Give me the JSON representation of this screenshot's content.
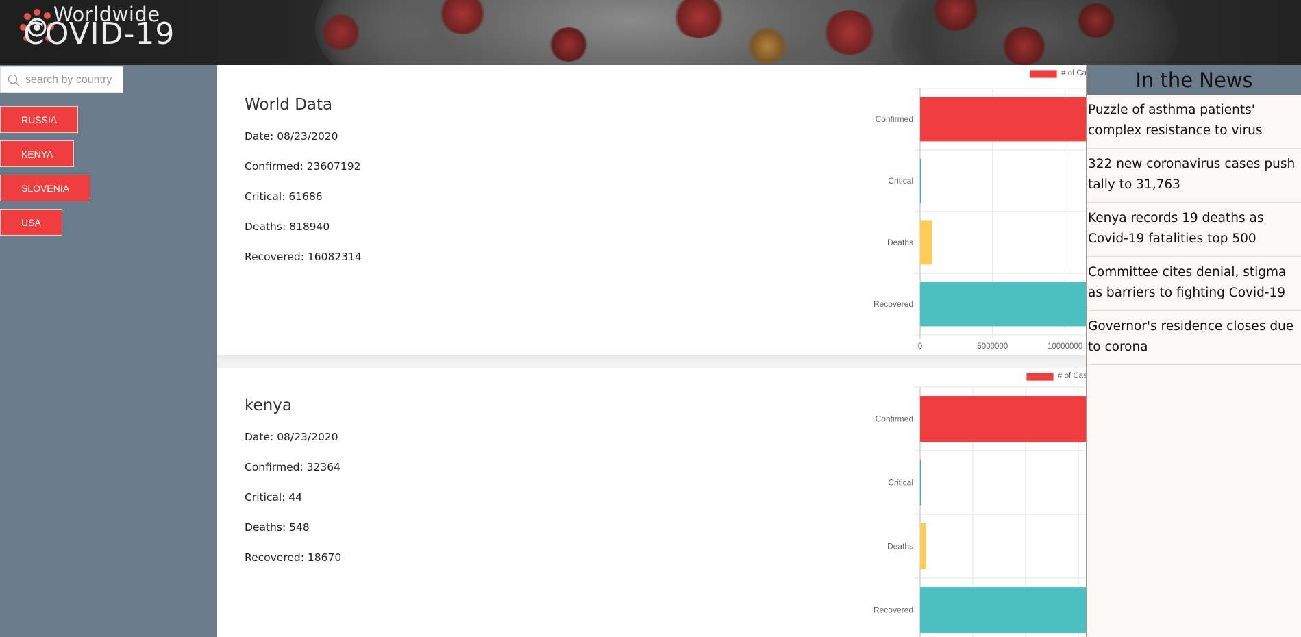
{
  "header": {
    "logo_line1": "Worldwide",
    "logo_line2": "COVID-19"
  },
  "search": {
    "placeholder": "search by country"
  },
  "sidebar": {
    "countries": [
      "RUSSIA",
      "KENYA",
      "SLOVENIA",
      "USA"
    ]
  },
  "world": {
    "title": "World Data",
    "date": "Date: 08/23/2020",
    "confirmed": "Confirmed: 23607192",
    "critical": "Critical: 61686",
    "deaths": "Deaths: 818940",
    "recovered": "Recovered: 16082314"
  },
  "country": {
    "title": "kenya",
    "date": "Date: 08/23/2020",
    "confirmed": "Confirmed: 32364",
    "critical": "Critical: 44",
    "deaths": "Deaths: 548",
    "recovered": "Recovered: 18670"
  },
  "news": {
    "title": "In the News",
    "items": [
      "Puzzle of asthma patients' complex resistance to virus",
      "322 new coronavirus cases push tally to 31,763",
      "Kenya records 19 deaths as Covid-19 fatalities top 500",
      "Committee cites denial, stigma as barriers to fighting Covid-19",
      "Governor's residence closes due to corona"
    ]
  },
  "colors": {
    "confirmed": "#f03e3e",
    "critical": "#36a2eb",
    "deaths": "#ffcd56",
    "recovered": "#4bc0c0",
    "button": "#f03e3e"
  },
  "chart_data": [
    {
      "type": "bar",
      "orientation": "horizontal",
      "legend": "# of Cases Worldwide",
      "categories": [
        "Confirmed",
        "Critical",
        "Deaths",
        "Recovered"
      ],
      "values": [
        23607192,
        61686,
        818940,
        16082314
      ],
      "xlim": [
        0,
        25000000
      ],
      "xticks": [
        "0",
        "5000000",
        "10000000",
        "15000000",
        "20000000",
        "25000000"
      ],
      "grid": true,
      "legend_position": "top"
    },
    {
      "type": "bar",
      "orientation": "horizontal",
      "legend": "# of Cases Countrywide",
      "categories": [
        "Confirmed",
        "Critical",
        "Deaths",
        "Recovered"
      ],
      "values": [
        32364,
        44,
        548,
        18670
      ],
      "xlim": [
        0,
        35000
      ],
      "grid": true,
      "legend_position": "top"
    }
  ]
}
